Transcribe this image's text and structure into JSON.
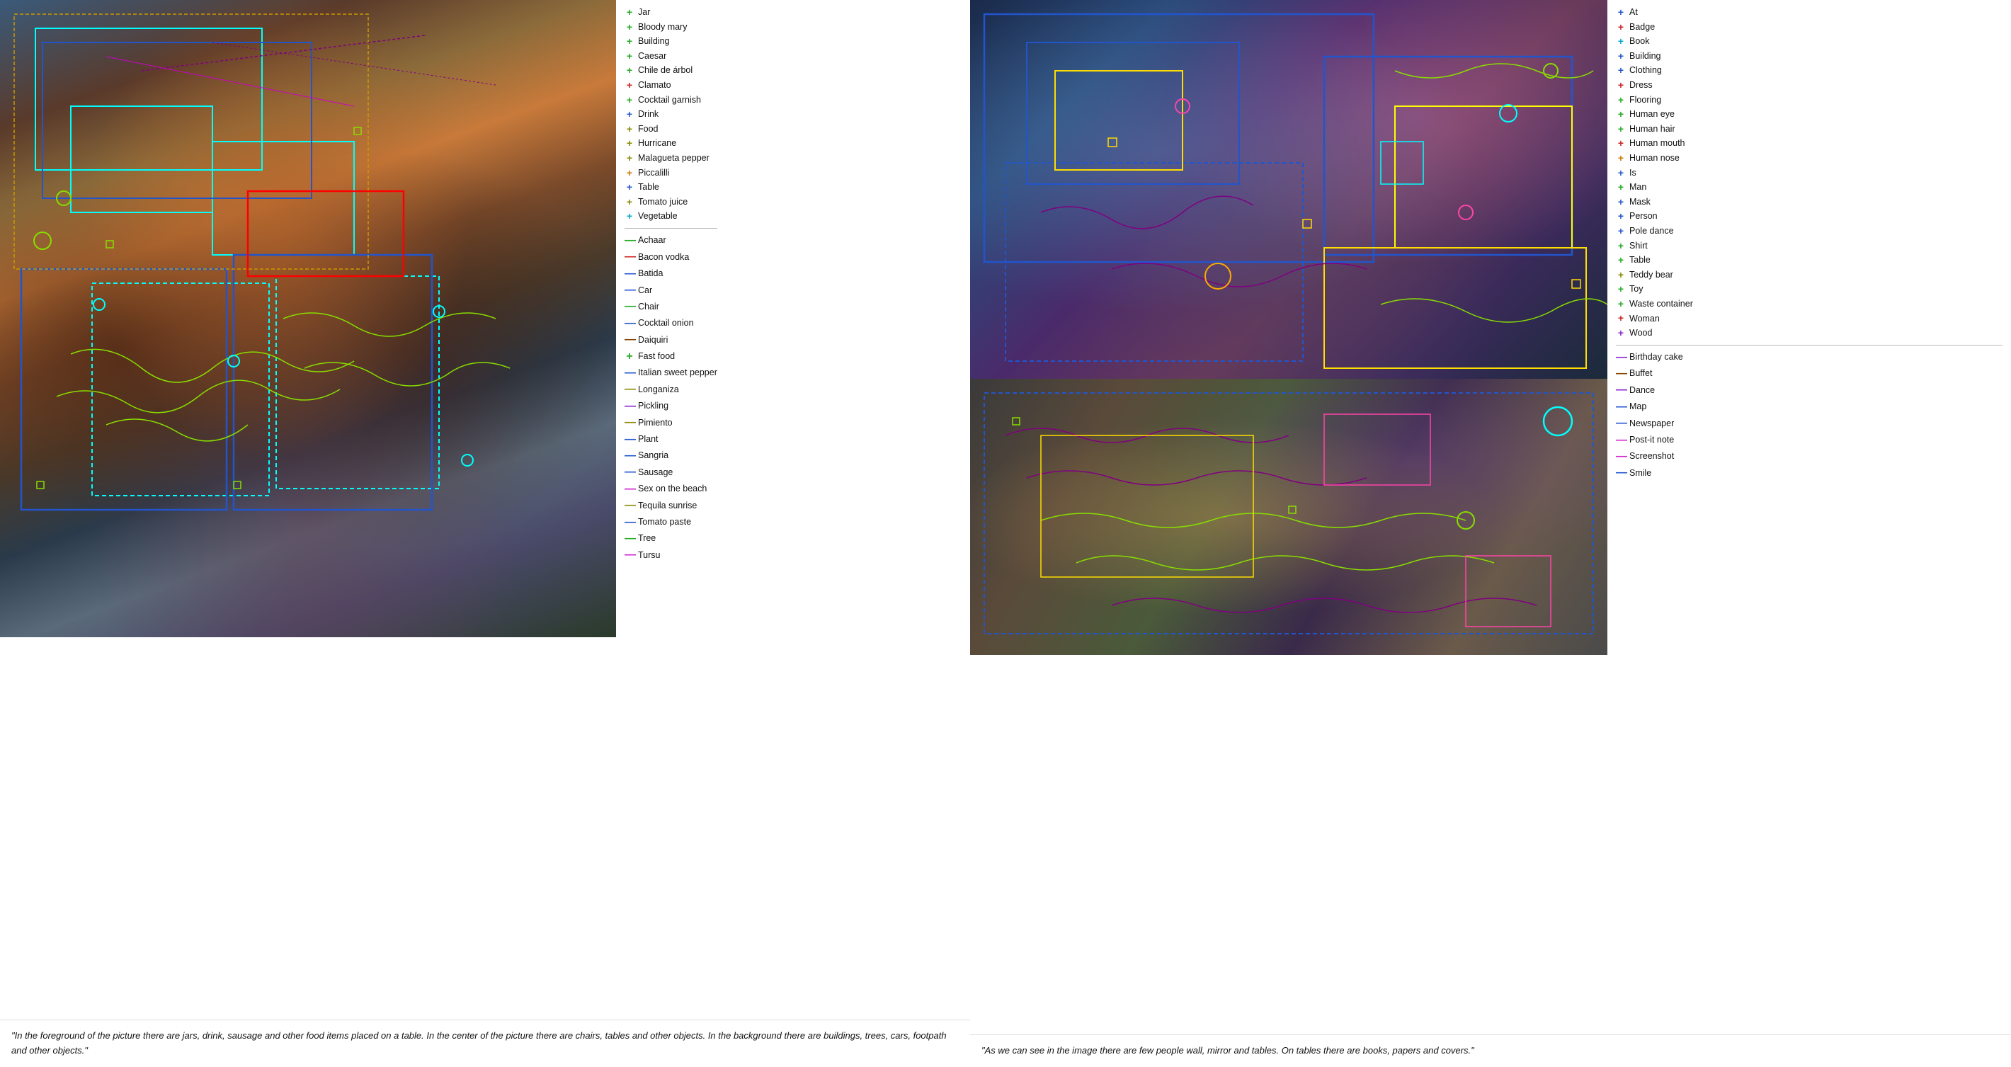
{
  "left": {
    "legend_col1": [
      {
        "icon": "+",
        "color": "green",
        "label": "Jar"
      },
      {
        "icon": "+",
        "color": "green",
        "label": "Bloody mary"
      },
      {
        "icon": "+",
        "color": "green",
        "label": "Building"
      },
      {
        "icon": "+",
        "color": "green",
        "label": "Caesar"
      },
      {
        "icon": "+",
        "color": "green",
        "label": "Chile de árbol"
      },
      {
        "icon": "+",
        "color": "red",
        "label": "Clamato"
      },
      {
        "icon": "+",
        "color": "green",
        "label": "Cocktail garnish"
      },
      {
        "icon": "+",
        "color": "blue",
        "label": "Drink"
      },
      {
        "icon": "+",
        "color": "olive",
        "label": "Food"
      },
      {
        "icon": "+",
        "color": "olive",
        "label": "Hurricane"
      },
      {
        "icon": "+",
        "color": "olive",
        "label": "Malagueta pepper"
      },
      {
        "icon": "+",
        "color": "orange",
        "label": "Piccalilli"
      },
      {
        "icon": "+",
        "color": "blue",
        "label": "Table"
      },
      {
        "icon": "+",
        "color": "olive",
        "label": "Tomato juice"
      },
      {
        "icon": "+",
        "color": "cyan",
        "label": "Vegetable"
      }
    ],
    "legend_col2": [
      {
        "icon": "—",
        "color": "green",
        "label": "Achaar"
      },
      {
        "icon": "—",
        "color": "red",
        "label": "Bacon vodka"
      },
      {
        "icon": "—",
        "color": "blue",
        "label": "Batida"
      },
      {
        "icon": "—",
        "color": "blue",
        "label": "Car"
      },
      {
        "icon": "—",
        "color": "green",
        "label": "Chair"
      },
      {
        "icon": "—",
        "color": "blue",
        "label": "Cocktail onion"
      },
      {
        "icon": "—",
        "color": "brown",
        "label": "Daiquiri"
      },
      {
        "icon": "+",
        "color": "green",
        "label": "Fast food"
      },
      {
        "icon": "—",
        "color": "blue",
        "label": "Italian sweet pepper"
      },
      {
        "icon": "—",
        "color": "olive",
        "label": "Longaniza"
      },
      {
        "icon": "—",
        "color": "purple",
        "label": "Pickling"
      },
      {
        "icon": "—",
        "color": "olive",
        "label": "Pimiento"
      },
      {
        "icon": "—",
        "color": "blue",
        "label": "Plant"
      },
      {
        "icon": "—",
        "color": "blue",
        "label": "Sangria"
      },
      {
        "icon": "—",
        "color": "blue",
        "label": "Sausage"
      },
      {
        "icon": "—",
        "color": "magenta",
        "label": "Sex on the beach"
      },
      {
        "icon": "—",
        "color": "olive",
        "label": "Tequila sunrise"
      },
      {
        "icon": "—",
        "color": "blue",
        "label": "Tomato paste"
      },
      {
        "icon": "—",
        "color": "green",
        "label": "Tree"
      },
      {
        "icon": "—",
        "color": "magenta",
        "label": "Tursu"
      }
    ],
    "caption": "\"In the foreground of the picture there are jars, drink, sausage and other food items placed on a table.\nIn the center of the picture there are chairs, tables and other objects.\nIn the background there are buildings, trees, cars, footpath and other objects.\""
  },
  "right": {
    "legend_col1": [
      {
        "icon": "+",
        "color": "blue",
        "label": "At"
      },
      {
        "icon": "+",
        "color": "red",
        "label": "Badge"
      },
      {
        "icon": "+",
        "color": "cyan",
        "label": "Book"
      },
      {
        "icon": "+",
        "color": "blue",
        "label": "Building"
      },
      {
        "icon": "+",
        "color": "blue",
        "label": "Clothing"
      },
      {
        "icon": "+",
        "color": "red",
        "label": "Dress"
      },
      {
        "icon": "+",
        "color": "green",
        "label": "Flooring"
      },
      {
        "icon": "+",
        "color": "green",
        "label": "Human eye"
      },
      {
        "icon": "+",
        "color": "green",
        "label": "Human hair"
      },
      {
        "icon": "+",
        "color": "red",
        "label": "Human mouth"
      },
      {
        "icon": "+",
        "color": "orange",
        "label": "Human nose"
      },
      {
        "icon": "+",
        "color": "blue",
        "label": "Is"
      },
      {
        "icon": "+",
        "color": "green",
        "label": "Man"
      },
      {
        "icon": "+",
        "color": "blue",
        "label": "Mask"
      },
      {
        "icon": "+",
        "color": "blue",
        "label": "Person"
      },
      {
        "icon": "+",
        "color": "blue",
        "label": "Pole dance"
      },
      {
        "icon": "+",
        "color": "green",
        "label": "Shirt"
      },
      {
        "icon": "+",
        "color": "green",
        "label": "Table"
      },
      {
        "icon": "+",
        "color": "olive",
        "label": "Teddy bear"
      },
      {
        "icon": "+",
        "color": "green",
        "label": "Toy"
      },
      {
        "icon": "+",
        "color": "green",
        "label": "Waste container"
      },
      {
        "icon": "+",
        "color": "red",
        "label": "Woman"
      },
      {
        "icon": "+",
        "color": "purple",
        "label": "Wood"
      }
    ],
    "legend_col2": [
      {
        "icon": "—",
        "color": "purple",
        "label": "Birthday cake"
      },
      {
        "icon": "—",
        "color": "brown",
        "label": "Buffet"
      },
      {
        "icon": "—",
        "color": "purple",
        "label": "Dance"
      },
      {
        "icon": "—",
        "color": "blue",
        "label": "Map"
      },
      {
        "icon": "—",
        "color": "blue",
        "label": "Newspaper"
      },
      {
        "icon": "—",
        "color": "magenta",
        "label": "Post-it note"
      },
      {
        "icon": "—",
        "color": "magenta",
        "label": "Screenshot"
      },
      {
        "icon": "—",
        "color": "blue",
        "label": "Smile"
      }
    ],
    "caption": "\"As we can see in the image there are few people wall, mirror and tables.\nOn tables there are books, papers and covers.\""
  }
}
